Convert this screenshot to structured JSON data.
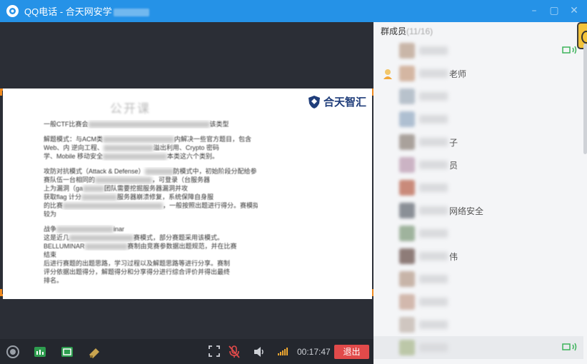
{
  "window": {
    "app_name": "QQ电话",
    "separator": " - ",
    "group_name": "合天网安学",
    "controls": [
      "minimize",
      "maximize",
      "close"
    ]
  },
  "slide": {
    "title": "公开课",
    "logo_text": "合天智汇",
    "lines_p1": [
      {
        "t": "一般CTF比赛会",
        "w": 170,
        "tail": "该类型"
      }
    ],
    "lines_p2": [
      {
        "t": "解题模式：与ACM类",
        "w": 100,
        "tail": "内解决一些官方题目，包含"
      },
      {
        "t": "Web、内 逆向工程、",
        "w": 70,
        "tail": "溢出利用、Crypto 密码"
      },
      {
        "t": "学、Mobile 移动安全",
        "w": 90,
        "tail": "本类这六个类别。"
      }
    ],
    "lines_p3": [
      {
        "t": "攻防对抗模式（Attack & Defense）",
        "w": 40,
        "tail": "防模式中，初始阶段分配给参"
      },
      {
        "t": "赛队伍一台相同的",
        "w": 80,
        "tail": "，可登录（台服务器"
      },
      {
        "t": "上为漏洞（ga",
        "w": 30,
        "tail": "团队需要挖掘服务器漏洞并攻"
      },
      {
        "t": "获取flag 计分",
        "w": 50,
        "tail": "服务器崩溃修复，系统保障自身服"
      },
      {
        "t": "的比赛",
        "w": 140,
        "tail": "，一般按照出题进行得分。赛模拟过程"
      },
      {
        "t": "较为",
        "w": 0,
        "tail": ""
      }
    ],
    "lines_p4": [
      {
        "t": "战争",
        "w": 80,
        "tail": "inar"
      },
      {
        "t": "这是近几",
        "w": 90,
        "tail": "赛模式，部分赛题采用该模式。"
      },
      {
        "t": "BELLUMINAR",
        "w": 60,
        "tail": "赛制由竞赛参数据出题规范，并在比赛"
      },
      {
        "t": "结束",
        "w": 0,
        "tail": ""
      },
      {
        "t": "后进行赛题的出题思路，学习过程以及解题思路等进行分享。赛制",
        "w": 0,
        "tail": ""
      },
      {
        "t": "评分依据出题得分，解题得分和分享得分进行综合评价并得出最终",
        "w": 0,
        "tail": ""
      },
      {
        "t": "排名。",
        "w": 0,
        "tail": ""
      }
    ]
  },
  "toolbar": {
    "timer": "00:17:47",
    "exit_label": "退出"
  },
  "panel": {
    "title_prefix": "群成员",
    "count": "(11/16)",
    "members": [
      {
        "name": "",
        "role": "",
        "avatar": "#c9b6a8"
      },
      {
        "name": "老师",
        "role": "teacher",
        "avatar": "#d4b6a2"
      },
      {
        "name": "",
        "role": "",
        "avatar": "#b8c2cc"
      },
      {
        "name": "",
        "role": "",
        "avatar": "#aebfd1"
      },
      {
        "name": "子",
        "role": "",
        "avatar": "#a9a19b"
      },
      {
        "name": "员",
        "role": "",
        "avatar": "#cbb3c4"
      },
      {
        "name": "",
        "role": "",
        "avatar": "#c98a7a"
      },
      {
        "name": "网络安全",
        "role": "",
        "avatar": "#8a8f96"
      },
      {
        "name": "",
        "role": "",
        "avatar": "#9fb39d"
      },
      {
        "name": "伟",
        "role": "",
        "avatar": "#8e7c78"
      },
      {
        "name": "",
        "role": "",
        "avatar": "#c7b4a8"
      },
      {
        "name": "",
        "role": "",
        "avatar": "#d2b8ad"
      },
      {
        "name": "",
        "role": "",
        "avatar": "#cfc6c0"
      },
      {
        "name": "",
        "role": "",
        "avatar": "#bcc7a8"
      }
    ]
  },
  "colors": {
    "titlebar": "#2592e7",
    "exit": "#e14a4a",
    "frame": "#f08a1f",
    "slide_bar": "#2c67b5"
  }
}
